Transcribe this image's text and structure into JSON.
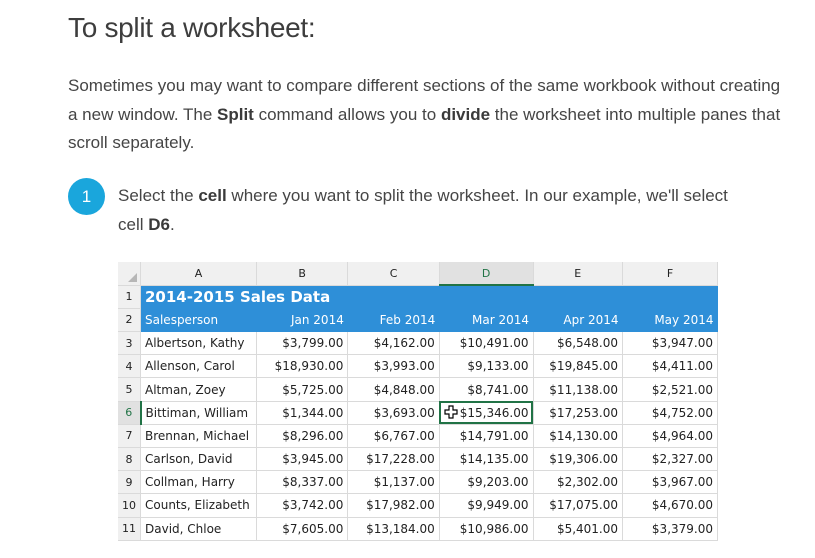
{
  "title": "To split a worksheet:",
  "intro": {
    "p1": "Sometimes you may want to compare different sections of the same workbook without creating a new window. The ",
    "b1": "Split",
    "p2": " command allows you to ",
    "b2": "divide",
    "p3": " the worksheet into multiple panes that scroll separately."
  },
  "step": {
    "number": "1",
    "t1": "Select the ",
    "b1": "cell",
    "t2": " where you want to split the worksheet. In our example, we'll select cell ",
    "b2": "D6",
    "t3": "."
  },
  "sheet": {
    "columns": [
      "A",
      "B",
      "C",
      "D",
      "E",
      "F"
    ],
    "selected_column": "D",
    "selected_row": "6",
    "active_cell": "D6",
    "banner": "2014-2015 Sales Data",
    "headers": [
      "Salesperson",
      "Jan 2014",
      "Feb 2014",
      "Mar 2014",
      "Apr 2014",
      "May 2014"
    ],
    "row_numbers": [
      "1",
      "2",
      "3",
      "4",
      "5",
      "6",
      "7",
      "8",
      "9",
      "10",
      "11"
    ],
    "rows": [
      [
        "Albertson, Kathy",
        "$3,799.00",
        "$4,162.00",
        "$10,491.00",
        "$6,548.00",
        "$3,947.00"
      ],
      [
        "Allenson, Carol",
        "$18,930.00",
        "$3,993.00",
        "$9,133.00",
        "$19,845.00",
        "$4,411.00"
      ],
      [
        "Altman, Zoey",
        "$5,725.00",
        "$4,848.00",
        "$8,741.00",
        "$11,138.00",
        "$2,521.00"
      ],
      [
        "Bittiman, William",
        "$1,344.00",
        "$3,693.00",
        "$15,346.00",
        "$17,253.00",
        "$4,752.00"
      ],
      [
        "Brennan, Michael",
        "$8,296.00",
        "$6,767.00",
        "$14,791.00",
        "$14,130.00",
        "$4,964.00"
      ],
      [
        "Carlson, David",
        "$3,945.00",
        "$17,228.00",
        "$14,135.00",
        "$19,306.00",
        "$2,327.00"
      ],
      [
        "Collman, Harry",
        "$8,337.00",
        "$1,137.00",
        "$9,203.00",
        "$2,302.00",
        "$3,967.00"
      ],
      [
        "Counts, Elizabeth",
        "$3,742.00",
        "$17,982.00",
        "$9,949.00",
        "$17,075.00",
        "$4,670.00"
      ],
      [
        "David, Chloe",
        "$7,605.00",
        "$13,184.00",
        "$10,986.00",
        "$5,401.00",
        "$3,379.00"
      ]
    ],
    "colors": {
      "header_fill": "#2e8fd8",
      "selection": "#217346",
      "step_badge": "#1aa6dc"
    },
    "cursor_icon": "cell-select-cross-icon"
  }
}
